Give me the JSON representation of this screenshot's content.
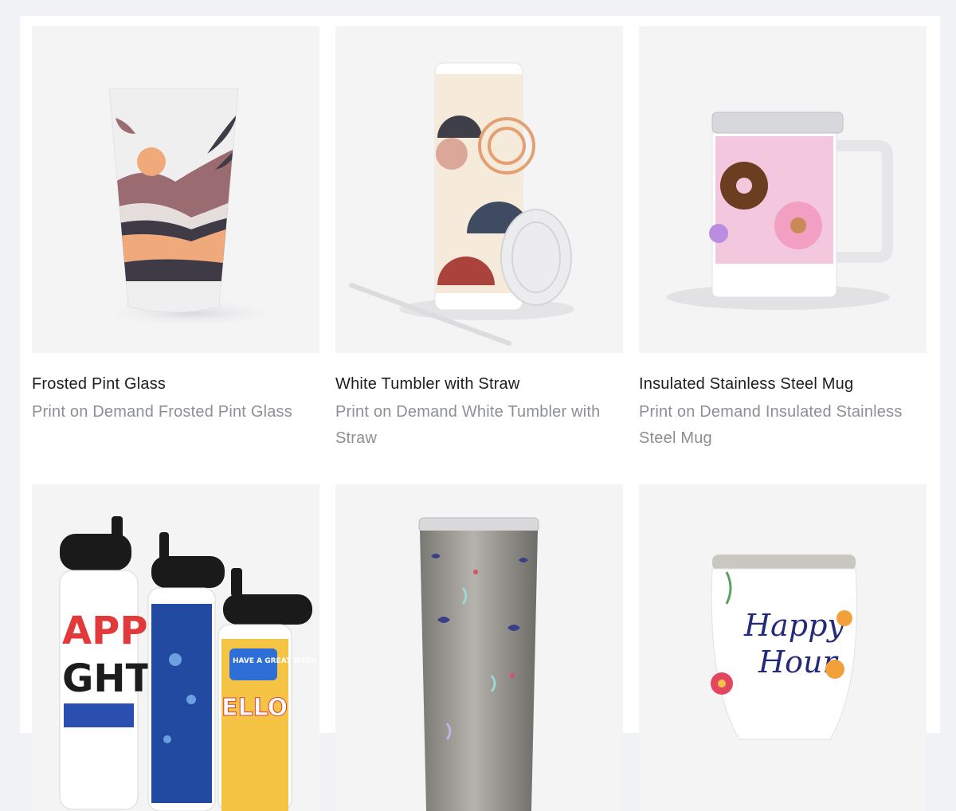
{
  "products": [
    {
      "title": "Frosted Pint Glass",
      "description": "Print on Demand Frosted Pint Glass",
      "image_icon": "frosted-pint-glass-image"
    },
    {
      "title": "White Tumbler with Straw",
      "description": "Print on Demand White Tumbler with Straw",
      "image_icon": "white-tumbler-image"
    },
    {
      "title": "Insulated Stainless Steel Mug",
      "description": "Print on Demand Insulated Stainless Steel Mug",
      "image_icon": "stainless-mug-image"
    },
    {
      "title": "",
      "description": "",
      "image_icon": "water-bottles-image",
      "printed_text": [
        "APPY",
        "GHT",
        "HAVE A GREAT WEEK",
        "ELLO"
      ]
    },
    {
      "title": "",
      "description": "",
      "image_icon": "steel-tumbler-image"
    },
    {
      "title": "",
      "description": "",
      "image_icon": "wine-tumbler-image",
      "printed_text": [
        "Happy",
        "Hour"
      ]
    }
  ],
  "colors": {
    "page_background": "#f1f2f6",
    "panel_background": "#ffffff",
    "image_background": "#f4f4f5",
    "title_text": "#1d1d22",
    "description_text": "#8d8f96"
  }
}
